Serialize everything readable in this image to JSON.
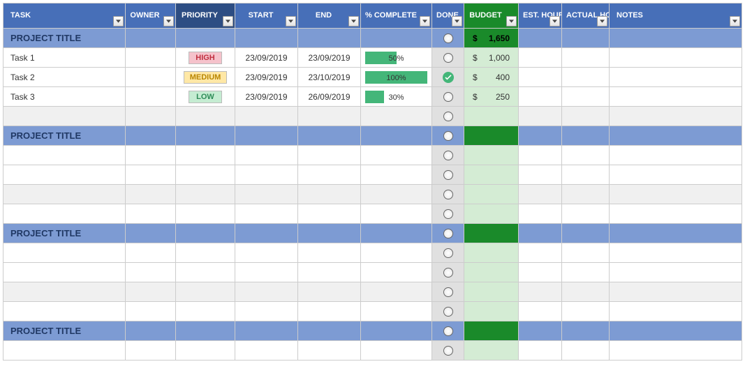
{
  "headers": {
    "task": "TASK",
    "owner": "OWNER",
    "priority": "PRIORITY",
    "start": "START",
    "end": "END",
    "complete": "% COMPLETE",
    "done": "DONE",
    "budget": "BUDGET",
    "est": "EST. HOURS",
    "act": "ACTUAL HOURS",
    "notes": "NOTES"
  },
  "group_label": "PROJECT TITLE",
  "project1_budget_sym": "$",
  "project1_budget_val": "1,650",
  "rows": [
    {
      "task": "Task 1",
      "priority": "HIGH",
      "prio_class": "prio-high",
      "start": "23/09/2019",
      "end": "23/09/2019",
      "pct": 50,
      "done": false,
      "budget_sym": "$",
      "budget_val": "1,000"
    },
    {
      "task": "Task 2",
      "priority": "MEDIUM",
      "prio_class": "prio-medium",
      "start": "23/09/2019",
      "end": "23/10/2019",
      "pct": 100,
      "done": true,
      "budget_sym": "$",
      "budget_val": "400"
    },
    {
      "task": "Task 3",
      "priority": "LOW",
      "prio_class": "prio-low",
      "start": "23/09/2019",
      "end": "26/09/2019",
      "pct": 30,
      "done": false,
      "budget_sym": "$",
      "budget_val": "250"
    }
  ]
}
